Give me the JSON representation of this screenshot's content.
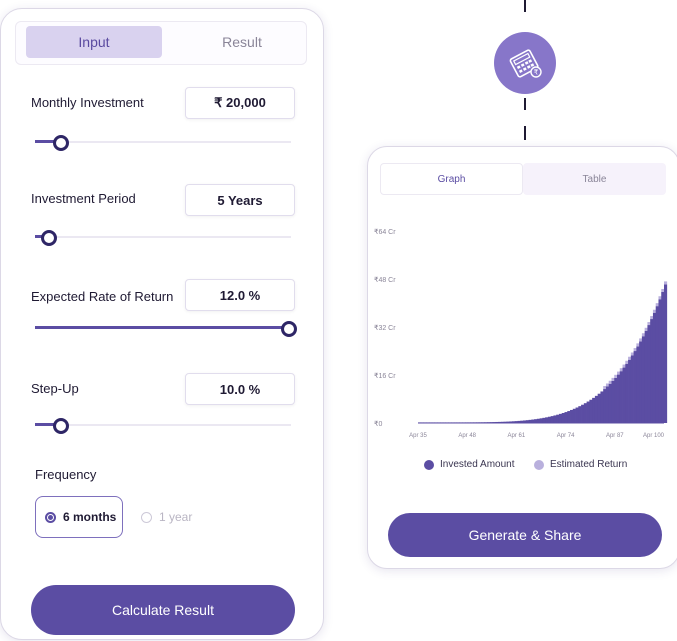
{
  "input_card": {
    "tabs": [
      {
        "label": "Input",
        "active": true
      },
      {
        "label": "Result",
        "active": false
      }
    ],
    "fields": [
      {
        "label": "Monthly Investment",
        "value": "₹ 20,000",
        "slider_fraction": 0.1
      },
      {
        "label": "Investment Period",
        "value": "5 Years",
        "slider_fraction": 0.04
      },
      {
        "label": "Expected Rate of Return",
        "value": "12.0 %",
        "slider_fraction": 1.0
      },
      {
        "label": "Step-Up",
        "value": "10.0 %",
        "slider_fraction": 0.1
      }
    ],
    "frequency": {
      "label": "Frequency",
      "options": [
        {
          "label": "6 months",
          "selected": true
        },
        {
          "label": "1 year",
          "selected": false
        }
      ]
    },
    "calculate_button": "Calculate Result"
  },
  "result_card": {
    "tabs": [
      {
        "label": "Graph",
        "active": true
      },
      {
        "label": "Table",
        "active": false
      }
    ],
    "legend": [
      {
        "label": "Invested Amount",
        "color": "#5b4da3"
      },
      {
        "label": "Estimated Return",
        "color": "#b9b0dd"
      }
    ],
    "share_button": "Generate & Share"
  },
  "colors": {
    "accent": "#5b4da3",
    "accent_light": "#d9d2ef",
    "badge": "#8776c9"
  },
  "icons": {
    "badge_icon": "calculator-icon"
  },
  "chart_data": {
    "type": "area",
    "x": [
      "Apr 35",
      "Apr 48",
      "Apr 61",
      "Apr 74",
      "Apr 87",
      "Apr 100"
    ],
    "y_ticks": [
      "₹0",
      "₹16 Cr",
      "₹32 Cr",
      "₹48 Cr",
      "₹64 Cr"
    ],
    "ylim": [
      0,
      64
    ],
    "series": [
      {
        "name": "Invested Amount",
        "values": [
          0.2,
          0.8,
          2.0,
          5.0,
          14.0,
          46.0
        ]
      },
      {
        "name": "Estimated Return",
        "values": [
          0.1,
          0.4,
          1.0,
          2.5,
          7.0,
          0
        ]
      }
    ],
    "legend_position": "bottom",
    "grid": false
  }
}
